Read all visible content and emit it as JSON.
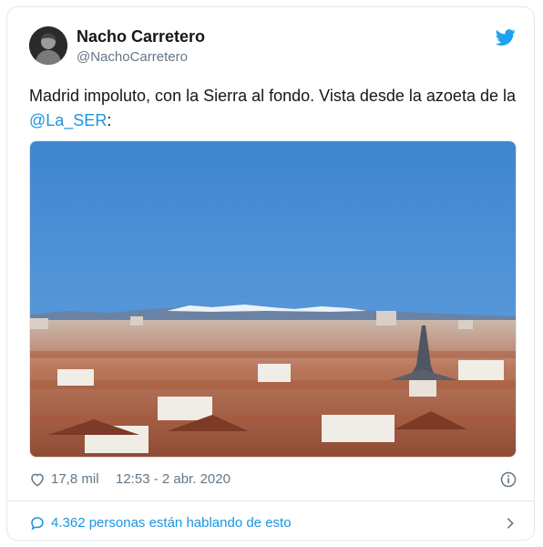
{
  "author": {
    "name": "Nacho Carretero",
    "handle": "@NachoCarretero",
    "avatar_icon": "user-avatar-photo"
  },
  "tweet": {
    "text_before": "Madrid impoluto, con la Sierra al fondo. Vista desde la azoeta de la ",
    "mention": "@La_SER",
    "text_after": ":"
  },
  "photo": {
    "subject": "Madrid rooftops skyline under a clear blue sky with snowy Sierra mountains on the horizon"
  },
  "meta": {
    "likes": "17,8 mil",
    "timestamp": "12:53 - 2 abr. 2020",
    "like_icon": "heart-icon",
    "info_icon": "info-icon"
  },
  "conversation": {
    "label": "4.362 personas están hablando de esto",
    "icon": "chat-bubble-icon",
    "chevron": "chevron-right-icon"
  },
  "colors": {
    "accent": "#1b95e0",
    "text": "#14171a",
    "muted": "#657786",
    "twitter_blue": "#1da1f2",
    "sky": "#4a8fd4",
    "roof": "#b5644a"
  }
}
